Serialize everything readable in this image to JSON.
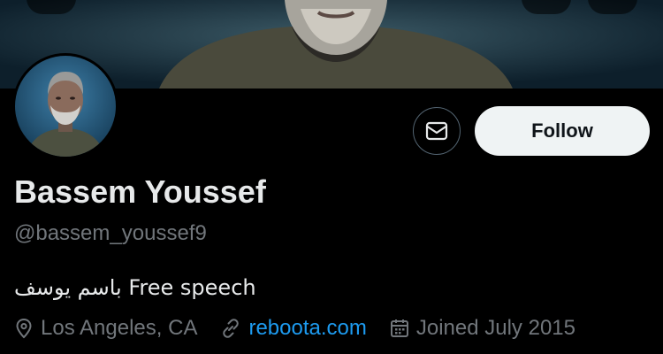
{
  "profile": {
    "name": "Bassem Youssef",
    "handle": "@bassem_youssef9",
    "bio": "باسم يوسف Free speech",
    "location": "Los Angeles, CA",
    "website": "reboota.com",
    "joined": "Joined July 2015"
  },
  "actions": {
    "follow_label": "Follow",
    "message_icon": "envelope-icon"
  },
  "banner": {
    "icons": [
      "back-arrow-icon",
      "search-icon",
      "more-icon"
    ]
  },
  "meta_icons": {
    "location": "location-pin-icon",
    "website": "link-icon",
    "joined": "calendar-icon"
  },
  "colors": {
    "background": "#000000",
    "text_primary": "#e7e9ea",
    "text_secondary": "#71767b",
    "link": "#1d9bf0",
    "follow_button_bg": "#eff3f4",
    "follow_button_text": "#0f1419"
  }
}
